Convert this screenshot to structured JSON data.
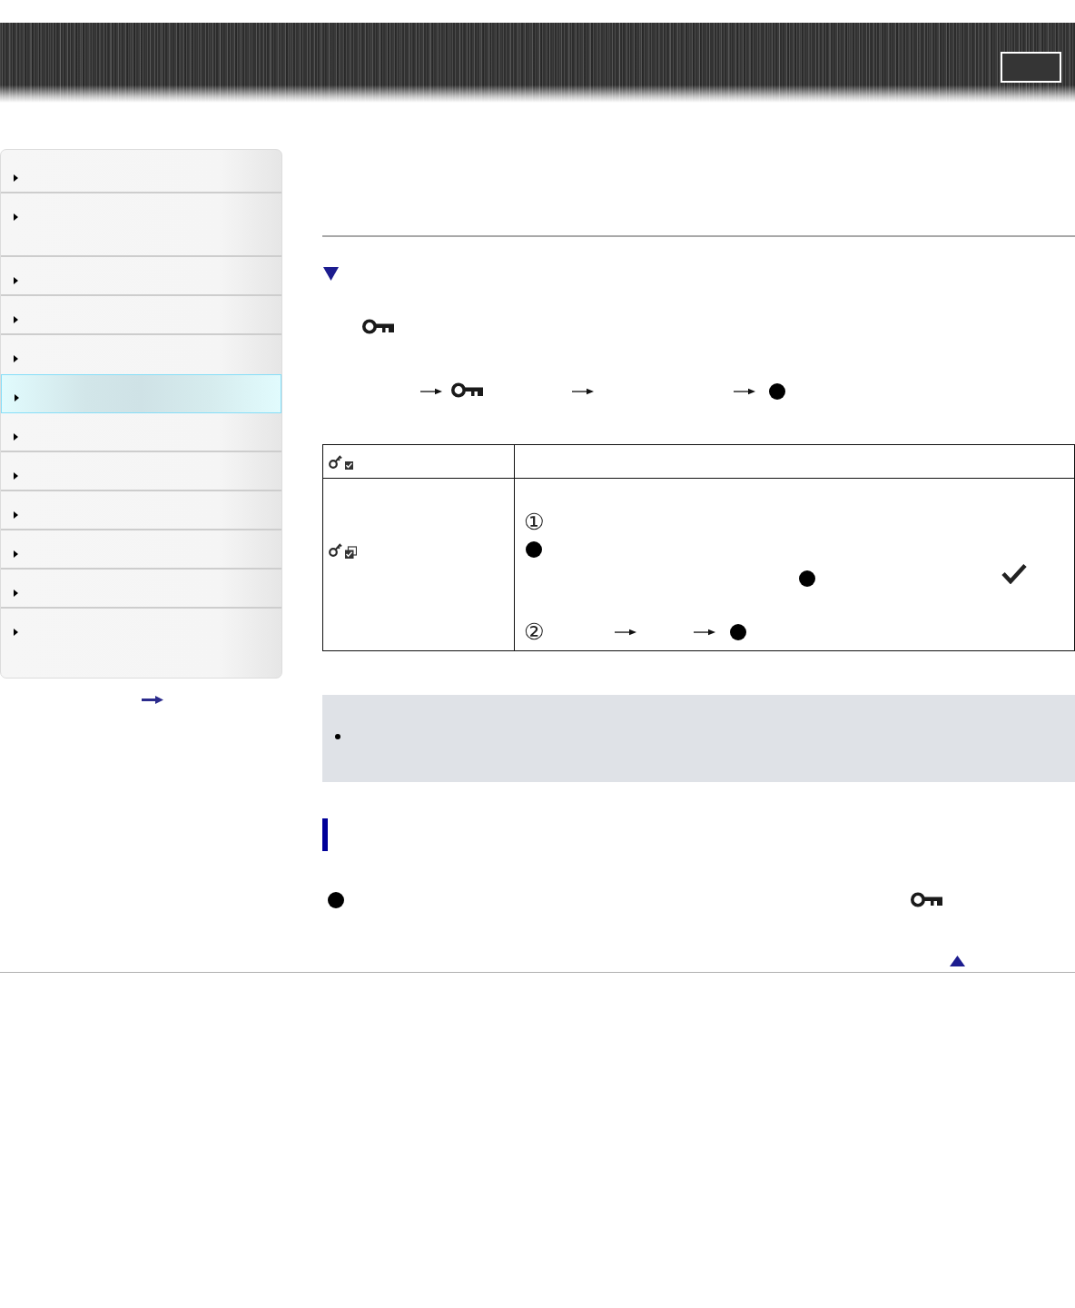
{
  "sidebar": {
    "items": [
      {
        "kind": "regular",
        "selected": false
      },
      {
        "kind": "tall",
        "selected": false
      },
      {
        "kind": "regular",
        "selected": false
      },
      {
        "kind": "regular",
        "selected": false
      },
      {
        "kind": "regular",
        "selected": false
      },
      {
        "kind": "regular",
        "selected": true
      },
      {
        "kind": "regular",
        "selected": false
      },
      {
        "kind": "regular",
        "selected": false
      },
      {
        "kind": "regular",
        "selected": false
      },
      {
        "kind": "regular",
        "selected": false
      },
      {
        "kind": "regular",
        "selected": false
      },
      {
        "kind": "tall",
        "selected": false
      }
    ]
  },
  "table": {
    "step_numbers": [
      "①",
      "②"
    ]
  }
}
